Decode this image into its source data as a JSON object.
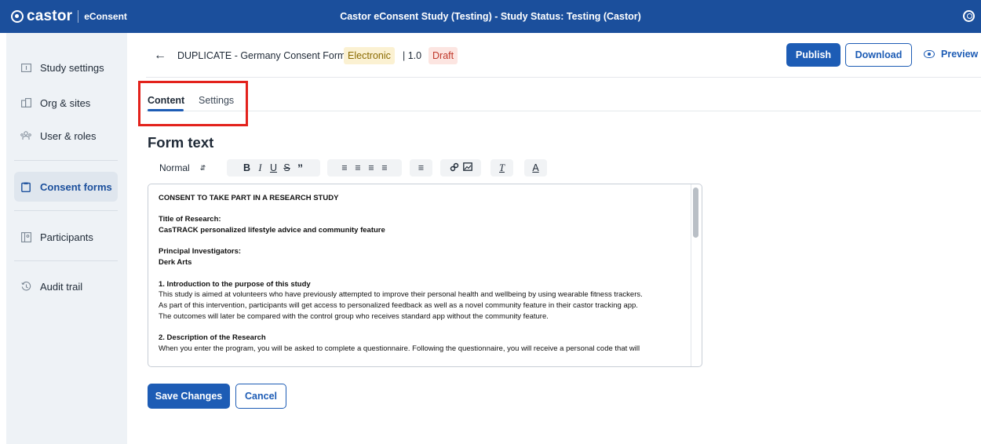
{
  "topbar": {
    "brand": "castor",
    "product": "eConsent",
    "title": "Castor eConsent Study (Testing)  - Study Status: Testing (Castor)"
  },
  "sidebar": {
    "items": [
      {
        "label": "Study settings",
        "icon": "study-settings-icon"
      },
      {
        "label": "Org & sites",
        "icon": "org-sites-icon"
      },
      {
        "label": "User & roles",
        "icon": "users-icon"
      },
      {
        "label": "Consent forms",
        "icon": "consent-forms-icon",
        "active": true
      },
      {
        "label": "Participants",
        "icon": "participants-icon"
      },
      {
        "label": "Audit trail",
        "icon": "history-icon"
      }
    ]
  },
  "header": {
    "form_title": "DUPLICATE - Germany Consent Form",
    "type_badge": "Electronic",
    "version": "| 1.0",
    "status_badge": "Draft",
    "publish_label": "Publish",
    "download_label": "Download",
    "preview_label": "Preview"
  },
  "tabs": [
    {
      "label": "Content",
      "active": true
    },
    {
      "label": "Settings",
      "active": false
    }
  ],
  "section_title": "Form text",
  "toolbar": {
    "format_select": "Normal",
    "buttons": [
      "B",
      "I",
      "U",
      "S",
      "quote",
      "ordered-list",
      "bullet-list",
      "indent-decrease",
      "indent-increase",
      "align",
      "link",
      "image",
      "clear-format",
      "text-color"
    ]
  },
  "editor": {
    "heading": "CONSENT TO TAKE PART IN A RESEARCH STUDY",
    "title_label": "Title of Research:",
    "title_value": "CasTRACK personalized lifestyle advice and community feature",
    "pi_label": "Principal Investigators:",
    "pi_value": "Derk Arts",
    "s1_heading": "1. Introduction to the purpose of this study",
    "s1_line1": "This study is aimed at volunteers who have previously attempted to improve their personal health and wellbeing by using wearable fitness trackers.",
    "s1_line2": "As part of this intervention, participants will get access to personalized feedback as well as a novel community feature in their castor tracking app.",
    "s1_line3": "The outcomes will later be compared with the control group who receives standard app without the community feature.",
    "s2_heading": "2. Description of the Research",
    "s2_line1": "When you enter the program, you will be asked to complete a questionnaire. Following the questionnaire, you will receive a personal code that will"
  },
  "actions": {
    "save_label": "Save Changes",
    "cancel_label": "Cancel"
  },
  "colors": {
    "topbar": "#1b4f9c",
    "primary": "#1d5cb5",
    "highlight_box": "#e3221c",
    "sidebar_bg": "#eef2f6"
  }
}
